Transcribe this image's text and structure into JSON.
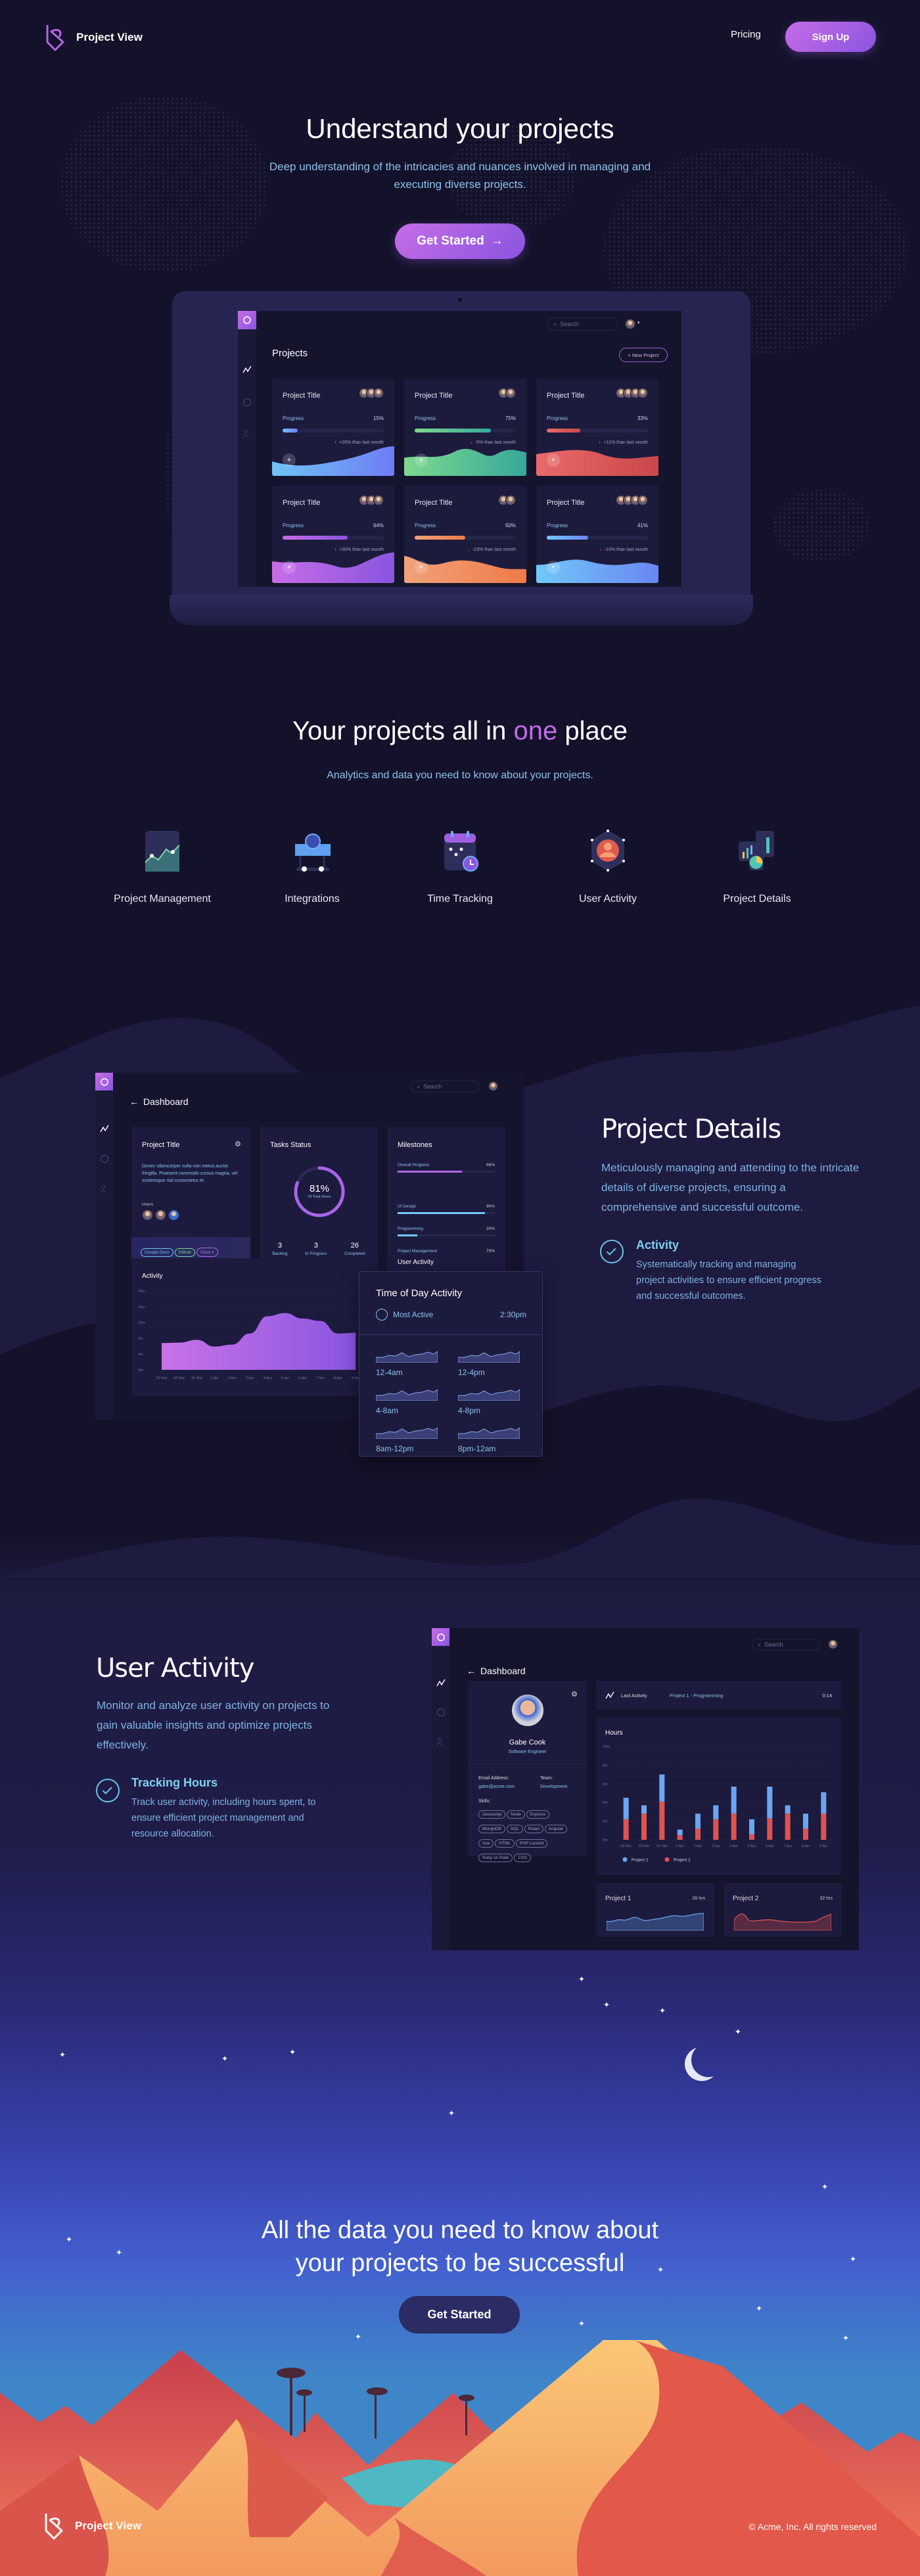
{
  "brand": {
    "name": "Project View",
    "accent": "#b565e6"
  },
  "nav": {
    "pricing": "Pricing",
    "signup": "Sign Up"
  },
  "hero": {
    "title": "Understand your projects",
    "subtitle": "Deep understanding of the intricacies and nuances involved in managing and executing diverse projects.",
    "cta": "Get Started",
    "cta_icon": "arrow-right-icon"
  },
  "laptop": {
    "search_placeholder": "Search",
    "page_title": "Projects",
    "new_project": "+ New Project",
    "cards": [
      {
        "title": "Project Title",
        "progress_label": "Progress",
        "progress": 15,
        "change": "+20% than last month",
        "trend": "up",
        "avatars": 3,
        "colors": [
          "#6fc3f5",
          "#6e7cf5"
        ]
      },
      {
        "title": "Project Title",
        "progress_label": "Progress",
        "progress": 75,
        "change": "-5% than last month",
        "trend": "down",
        "avatars": 2,
        "colors": [
          "#7ed88f",
          "#36a89a"
        ]
      },
      {
        "title": "Project Title",
        "progress_label": "Progress",
        "progress": 33,
        "change": "+11% than last month",
        "trend": "up",
        "avatars": 4,
        "colors": [
          "#e96a6a",
          "#c9474a"
        ]
      },
      {
        "title": "Project Title",
        "progress_label": "Progress",
        "progress": 64,
        "change": "+30% than last month",
        "trend": "up",
        "avatars": 3,
        "colors": [
          "#c66de6",
          "#8a55e0"
        ]
      },
      {
        "title": "Project Title",
        "progress_label": "Progress",
        "progress": 50,
        "change": "-23% than last month",
        "trend": "down",
        "avatars": 2,
        "colors": [
          "#f0a27a",
          "#f07a48"
        ]
      },
      {
        "title": "Project Title",
        "progress_label": "Progress",
        "progress": 41,
        "change": "-10% than last month",
        "trend": "down",
        "avatars": 4,
        "colors": [
          "#72c8f8",
          "#6a86f2"
        ]
      }
    ]
  },
  "features": {
    "title_pre": "Your projects all in ",
    "title_accent": "one",
    "title_post": " place",
    "subtitle": "Analytics and data you need to know about your projects.",
    "items": [
      {
        "label": "Project Management",
        "icon": "line-chart-icon"
      },
      {
        "label": "Integrations",
        "icon": "link-integration-icon"
      },
      {
        "label": "Time Tracking",
        "icon": "calendar-clock-icon"
      },
      {
        "label": "User Activity",
        "icon": "user-network-icon"
      },
      {
        "label": "Project Details",
        "icon": "charts-icon"
      }
    ]
  },
  "details": {
    "title": "Project Details",
    "paragraph": "Meticulously managing and attending to the intricate details of diverse projects, ensuring a comprehensive and successful outcome.",
    "feature_title": "Activity",
    "feature_text": "Systematically tracking and managing project activities to ensure efficient progress and successful outcomes.",
    "dashboard": {
      "title": "Dashboard",
      "search_placeholder": "Search",
      "project": {
        "title": "Project Title",
        "description": "Donec ullamcorper nulla non metus auctor fringilla. Praesent commodo cursus magna, vel scelerisque nisl consectetur et.",
        "users_label": "Users",
        "tags": [
          {
            "label": "Google Docs",
            "color": "#6cc4ec"
          },
          {
            "label": "Github",
            "color": "#7ed88f"
          },
          {
            "label": "Slack ▾",
            "color": "#b565e6"
          },
          {
            "label": "Harvest",
            "color": "#f0a27a"
          },
          {
            "label": "Wiki",
            "color": "#e96a6a"
          },
          {
            "label": "Jira",
            "color": "#6a86f2"
          }
        ]
      },
      "tasks": {
        "title": "Tasks Status",
        "percent": "81%",
        "percent_value": 81,
        "caption": "Of Total Hours",
        "stats": [
          {
            "value": "3",
            "label": "Backlog"
          },
          {
            "value": "3",
            "label": "In Progress"
          },
          {
            "value": "26",
            "label": "Completed"
          }
        ]
      },
      "milestones": {
        "title": "Milestones",
        "items": [
          {
            "label": "Overall Progress",
            "value": "66%",
            "pct": 66,
            "color": "#b565e6"
          },
          {
            "label": "UI Design",
            "value": "90%",
            "pct": 90,
            "color": "#72c8f8"
          },
          {
            "label": "Programming",
            "value": "20%",
            "pct": 20,
            "color": "#72c8f8"
          },
          {
            "label": "Project Management",
            "value": "70%",
            "pct": 70,
            "color": "#72c8f8"
          }
        ]
      },
      "user_activity_title": "User Activity",
      "time_of_day": {
        "title": "Time of Day Activity",
        "most_active_label": "Most Active",
        "most_active_value": "2:30pm",
        "slots": [
          "12-4am",
          "12-4pm",
          "4-8am",
          "4-8pm",
          "8am-12pm",
          "8pm-12am"
        ]
      }
    }
  },
  "chart_data": [
    {
      "type": "area",
      "title": "Activity",
      "categories": [
        "29 Mar",
        "30 Mar",
        "31 Mar",
        "1 Apr",
        "2 Apr",
        "3 Apr",
        "4 Apr",
        "5 Apr",
        "6 Apr",
        "7 Apr",
        "8 Apr",
        "9 Apr"
      ],
      "values": [
        6.8,
        6.9,
        7.6,
        5.9,
        6.4,
        9.2,
        13.6,
        14.4,
        13.0,
        12.4,
        9.2,
        9.4
      ],
      "y_ticks": [
        "0hr",
        "4hr",
        "8hr",
        "12hr",
        "16hr",
        "20hr"
      ],
      "ylim": [
        0,
        20
      ],
      "grid": true,
      "color": "#b565e6"
    },
    {
      "type": "bar",
      "stacked": true,
      "title": "Hours",
      "categories": [
        "29 Mar",
        "30 Mar",
        "31 Mar",
        "1 Apr",
        "2 Apr",
        "3 Apr",
        "4 Apr",
        "5 Apr",
        "6 Apr",
        "7 Apr",
        "8 Apr",
        "9 Apr"
      ],
      "series": [
        {
          "name": "Project 1",
          "color": "#6aa6f2",
          "values": [
            2.3,
            0.9,
            2.9,
            0.6,
            1.6,
            1.5,
            2.9,
            1.6,
            3.4,
            0.9,
            1.6,
            2.3
          ]
        },
        {
          "name": "Project 2",
          "color": "#e0524f",
          "values": [
            2.2,
            2.8,
            4.1,
            0.5,
            1.2,
            2.2,
            2.8,
            0.6,
            2.3,
            2.8,
            1.2,
            2.8
          ]
        }
      ],
      "y_ticks": [
        "0hr",
        "2hr",
        "4hr",
        "6hr",
        "8hr",
        "10hr"
      ],
      "ylim": [
        0,
        10
      ],
      "grid": true,
      "legend": "bottom-left"
    }
  ],
  "activity": {
    "title": "User Activity",
    "paragraph": "Monitor and analyze user activity on projects to gain valuable insights and optimize projects effectively.",
    "feature_title": "Tracking Hours",
    "feature_text": "Track user activity, including hours spent, to ensure efficient project management and resource allocation.",
    "dashboard": {
      "title": "Dashboard",
      "search_placeholder": "Search",
      "profile": {
        "name": "Gabe Cook",
        "role": "Software Engineer",
        "email_label": "Email Address:",
        "email": "gabe@acme.com",
        "team_label": "Team:",
        "team": "Development",
        "skills_label": "Skills:",
        "skills": [
          "Javascript",
          "Node",
          "Express",
          "MongoDB",
          "SQL",
          "React",
          "Angular",
          "Vue",
          "HTML",
          "PHP Laravel",
          "Ruby on Rails",
          "CSS"
        ]
      },
      "last_activity": {
        "label": "Last Activity",
        "project": "Project 1 - Programming",
        "time": "0:14"
      },
      "projects": [
        {
          "name": "Project 1",
          "hours": "26 hrs",
          "color": "#6aa6f2"
        },
        {
          "name": "Project 2",
          "hours": "32 hrs",
          "color": "#e0524f"
        }
      ]
    }
  },
  "cta": {
    "title_line1": "All the data you need to know about",
    "title_line2": "your projects to be successful",
    "button": "Get Started"
  },
  "footer": {
    "copyright": "© Acme, Inc. All rights reserved"
  }
}
